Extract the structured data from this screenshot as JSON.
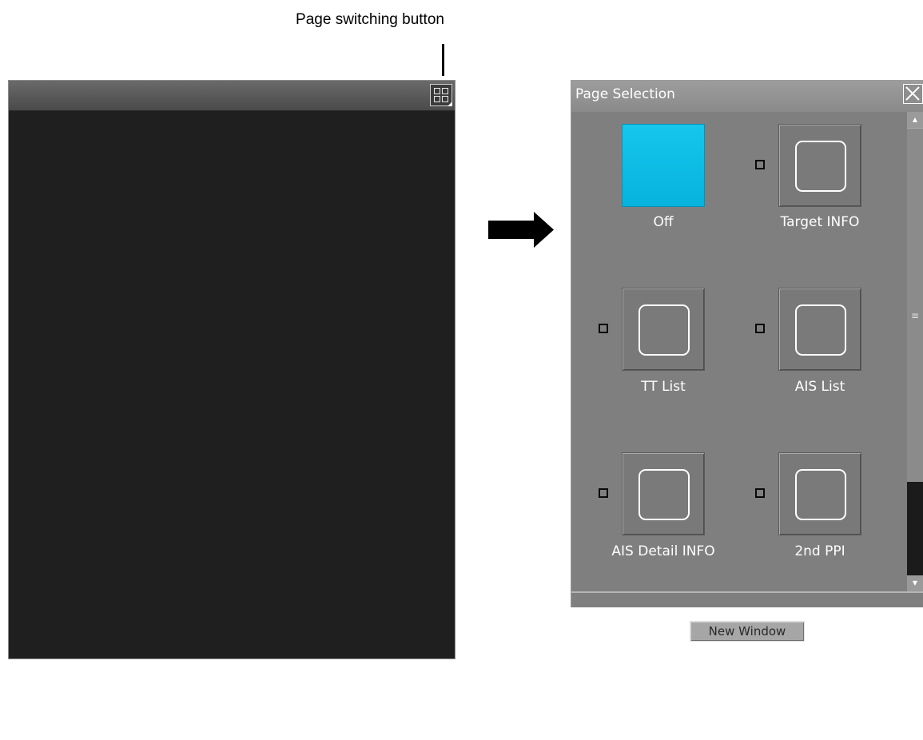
{
  "callout": {
    "label": "Page switching button"
  },
  "dialog": {
    "title": "Page Selection",
    "tiles": [
      {
        "label": "Off",
        "active": true,
        "has_checkbox": false
      },
      {
        "label": "Target INFO",
        "active": false,
        "has_checkbox": true
      },
      {
        "label": "TT List",
        "active": false,
        "has_checkbox": true
      },
      {
        "label": "AIS List",
        "active": false,
        "has_checkbox": true
      },
      {
        "label": "AIS Detail INFO",
        "active": false,
        "has_checkbox": true
      },
      {
        "label": "2nd PPI",
        "active": false,
        "has_checkbox": true
      },
      {
        "label": "",
        "active": false,
        "has_checkbox": true
      },
      {
        "label": "",
        "active": false,
        "has_checkbox": true
      }
    ],
    "new_window_label": "New Window"
  },
  "colors": {
    "active_tile": "#05b3dd",
    "dialog_bg": "#7f7f7f",
    "panel_bg": "#1f1f1f"
  },
  "icons": {
    "page_switch": "grid-icon",
    "close": "close-icon",
    "arrow": "right-arrow-icon"
  }
}
